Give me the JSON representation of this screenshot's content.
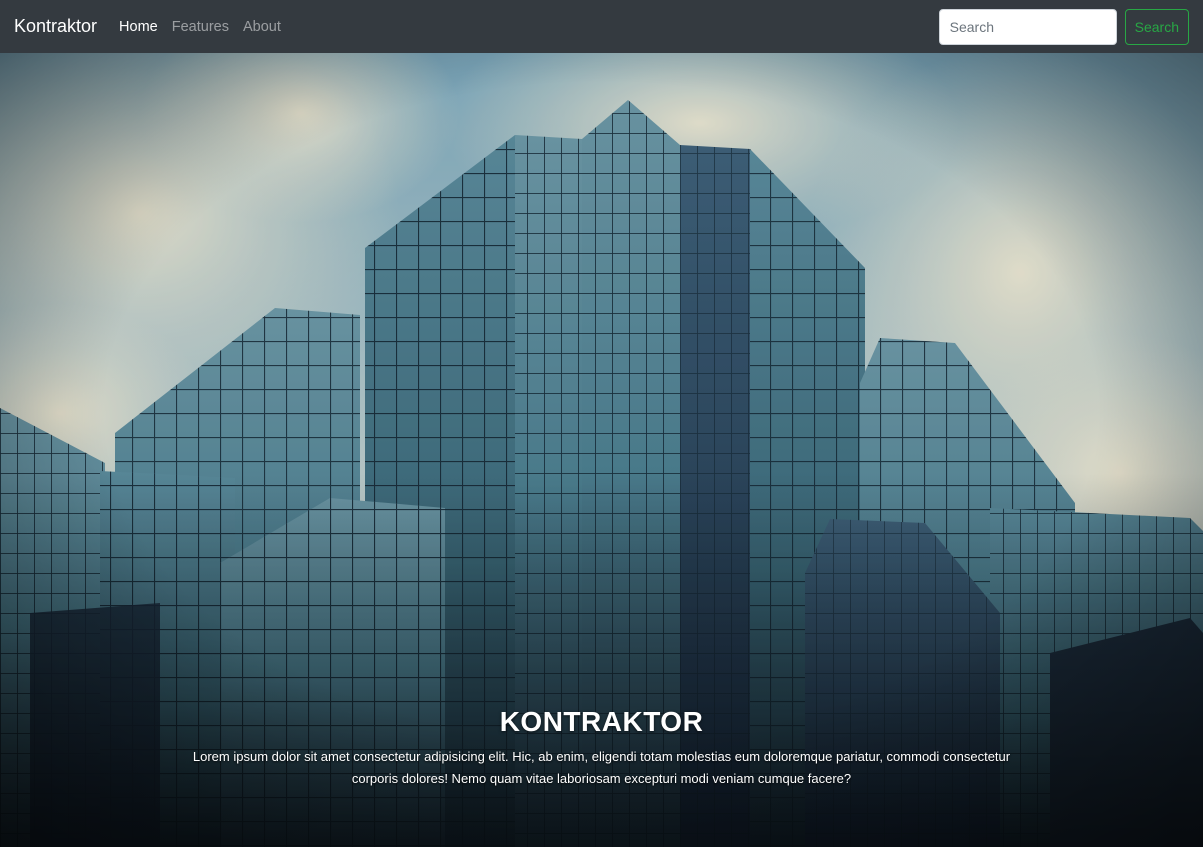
{
  "navbar": {
    "brand": "Kontraktor",
    "links": [
      {
        "label": "Home",
        "active": true
      },
      {
        "label": "Features",
        "active": false
      },
      {
        "label": "About",
        "active": false
      }
    ],
    "search": {
      "placeholder": "Search",
      "button_label": "Search"
    }
  },
  "hero": {
    "image": "glass-skyscraper-photo",
    "caption": {
      "title": "KONTRAKTOR",
      "text": "Lorem ipsum dolor sit amet consectetur adipisicing elit. Hic, ab enim, eligendi totam molestias eum doloremque pariatur, commodi consectetur corporis dolores! Nemo quam vitae laboriosam excepturi modi veniam cumque facere?"
    }
  },
  "colors": {
    "navbar_bg": "#343a40",
    "success": "#28a745",
    "sky": "#8fb4c4",
    "glass": "#3f6f80"
  }
}
